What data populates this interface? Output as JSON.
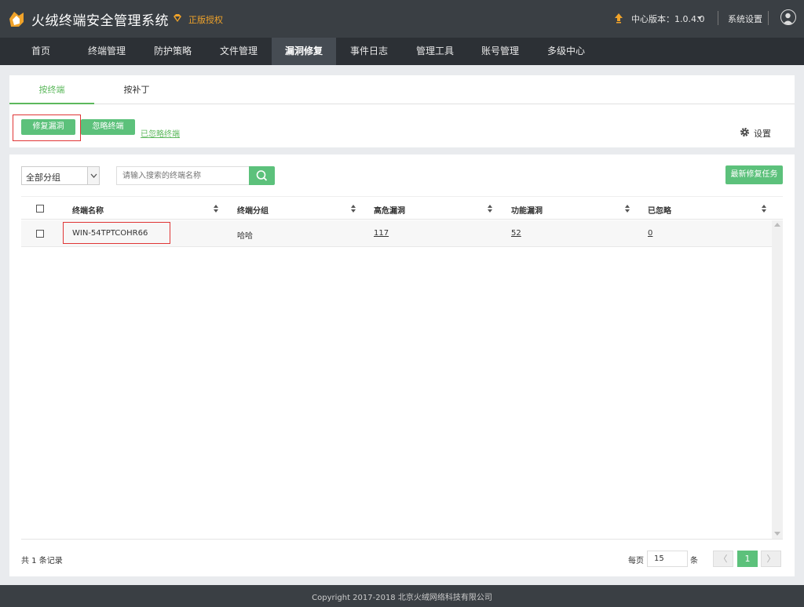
{
  "header": {
    "app_title": "火绒终端安全管理系统",
    "license": "正版授权",
    "version": "中心版本：1.0.4.0",
    "system_settings": "系统设置",
    "accent_color": "#f0a32a"
  },
  "nav": {
    "items": [
      "首页",
      "终端管理",
      "防护策略",
      "文件管理",
      "漏洞修复",
      "事件日志",
      "管理工具",
      "账号管理",
      "多级中心"
    ],
    "active": "漏洞修复"
  },
  "tabs": {
    "by_terminal": "按终端",
    "by_patch": "按补丁"
  },
  "actions": {
    "repair": "修复漏洞",
    "ignore_terminal": "忽略终端",
    "ignored_terminals_link": "已忽略终端",
    "settings": "设置"
  },
  "filter": {
    "group_selected": "全部分组",
    "search_placeholder": "请输入搜索的终端名称",
    "new_task": "最新修复任务"
  },
  "table": {
    "columns": [
      "终端名称",
      "终端分组",
      "高危漏洞",
      "功能漏洞",
      "已忽略"
    ],
    "rows": [
      {
        "name": "WIN-54TPTCOHR66",
        "group": "哈哈",
        "high_risk": "117",
        "functional": "52",
        "ignored": "0"
      }
    ]
  },
  "pagination": {
    "total": "共 1 条记录",
    "per_page_label": "每页",
    "per_page_value": "15",
    "per_page_unit": "条",
    "prev": "〈",
    "current_page": "1",
    "next": "〉"
  },
  "footer": {
    "copyright": "Copyright 2017-2018 北京火绒网络科技有限公司"
  },
  "colors": {
    "primary_green": "#5cc17b",
    "topbar": "#3a3f44",
    "nav": "#2c3035",
    "highlight_red": "#e03535"
  }
}
